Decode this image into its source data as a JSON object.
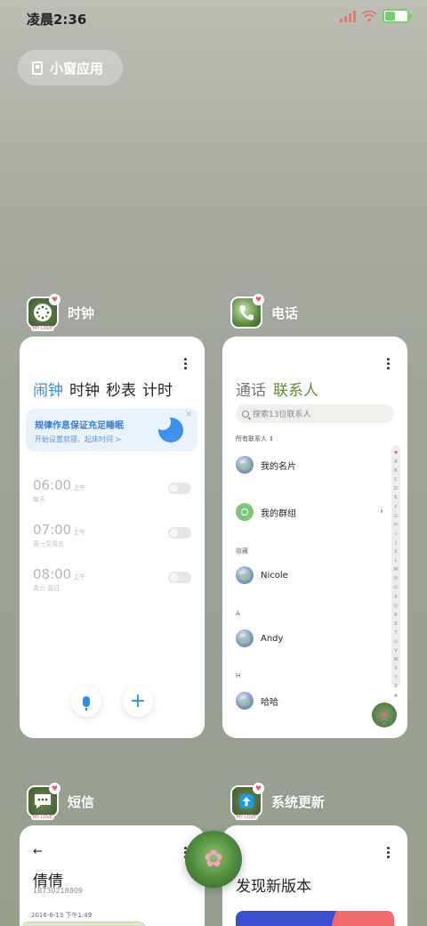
{
  "status_bar": {
    "time": "凌晨2:36"
  },
  "small_window": {
    "label": "小窗应用"
  },
  "clock_app": {
    "name": "时钟",
    "icon_badge": "MY LOVE",
    "tabs": [
      "闹钟",
      "时钟",
      "秒表",
      "计时"
    ],
    "banner": {
      "title": "规律作息保证充足睡眠",
      "subtitle": "开始设置就寝、起床时间 >"
    },
    "alarms": [
      {
        "time": "06:00",
        "ampm": "上午",
        "repeat": "每天"
      },
      {
        "time": "07:00",
        "ampm": "上午",
        "repeat": "周一至周五"
      },
      {
        "time": "08:00",
        "ampm": "上午",
        "repeat": "周六 周日"
      }
    ]
  },
  "phone_app": {
    "name": "电话",
    "icon_badge": "MY LOVE",
    "tabs": [
      "通话",
      "联系人"
    ],
    "search_placeholder": "搜索13位联系人",
    "all_contacts": "所有联系人",
    "my_card": "我的名片",
    "my_groups": "我的群组",
    "favorites_label": "收藏",
    "contacts": [
      {
        "section": "",
        "name": "Nicole"
      },
      {
        "section": "A",
        "name": "Andy"
      },
      {
        "section": "H",
        "name": "哈哈"
      }
    ],
    "alpha_index": [
      "♥",
      "A",
      "B",
      "C",
      "D",
      "E",
      "F",
      "G",
      "H",
      "I",
      "J",
      "K",
      "L",
      "M",
      "N",
      "O",
      "P",
      "Q",
      "R",
      "S",
      "T",
      "U",
      "V",
      "W",
      "X",
      "Y",
      "Z",
      "#"
    ]
  },
  "sms_app": {
    "name": "短信",
    "icon_badge": "MY LOVE",
    "contact_name": "倩倩",
    "contact_number": "18730218809",
    "date": "2016-6-13 下午1:49"
  },
  "update_app": {
    "name": "系统更新",
    "icon_badge": "MY LOVE",
    "title": "发现新版本"
  },
  "colors": {
    "accent_blue": "#2b8cf0",
    "contacts_green": "#5f8a3c"
  }
}
